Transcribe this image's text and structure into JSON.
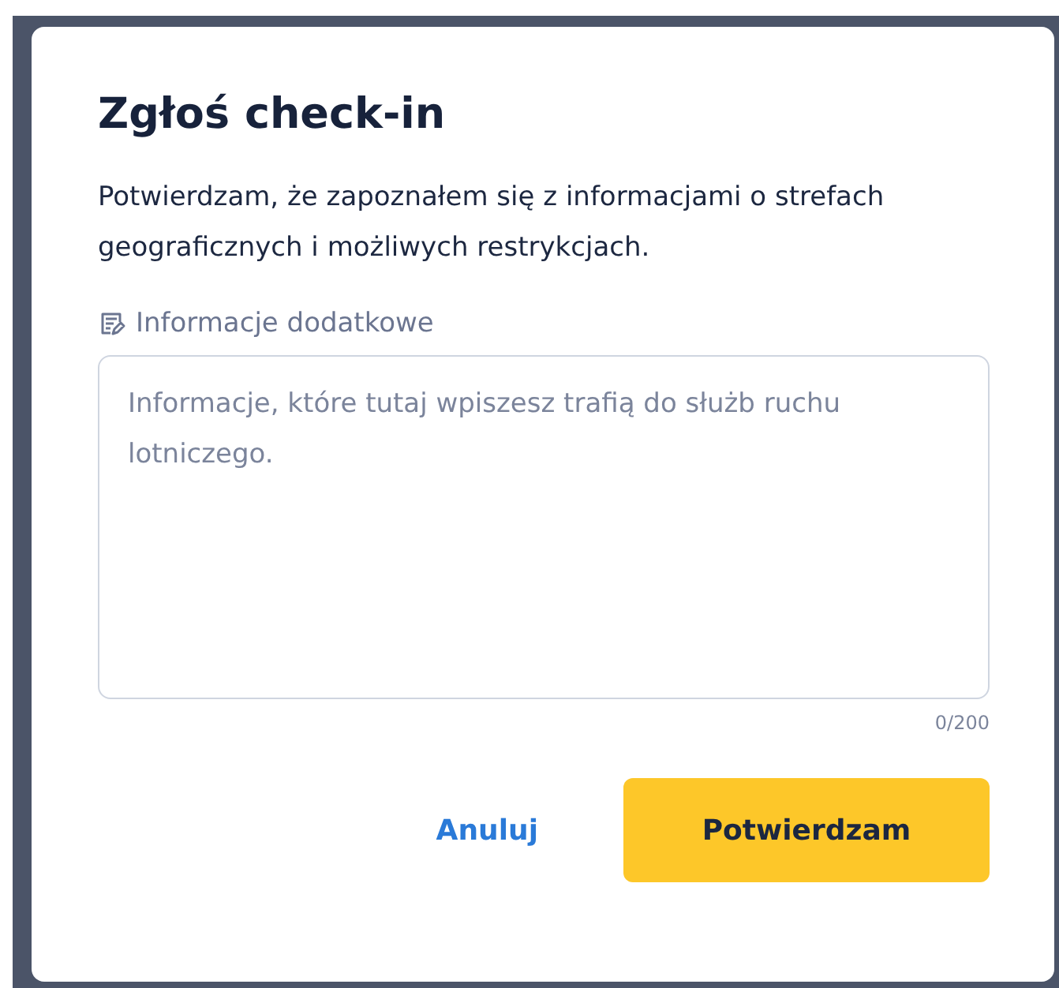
{
  "dialog": {
    "title": "Zgłoś check-in",
    "description": "Potwierdzam, że zapoznałem się z informacjami o strefach geograficznych i możliwych restrykcjach.",
    "field": {
      "label": "Informacje dodatkowe",
      "placeholder": "Informacje, które tutaj wpiszesz trafią do służb ruchu lotniczego.",
      "counter": "0/200"
    },
    "buttons": [
      {
        "label": "Anuluj",
        "kind": "text"
      },
      {
        "label": "Potwierdzam",
        "kind": "primary"
      }
    ]
  }
}
